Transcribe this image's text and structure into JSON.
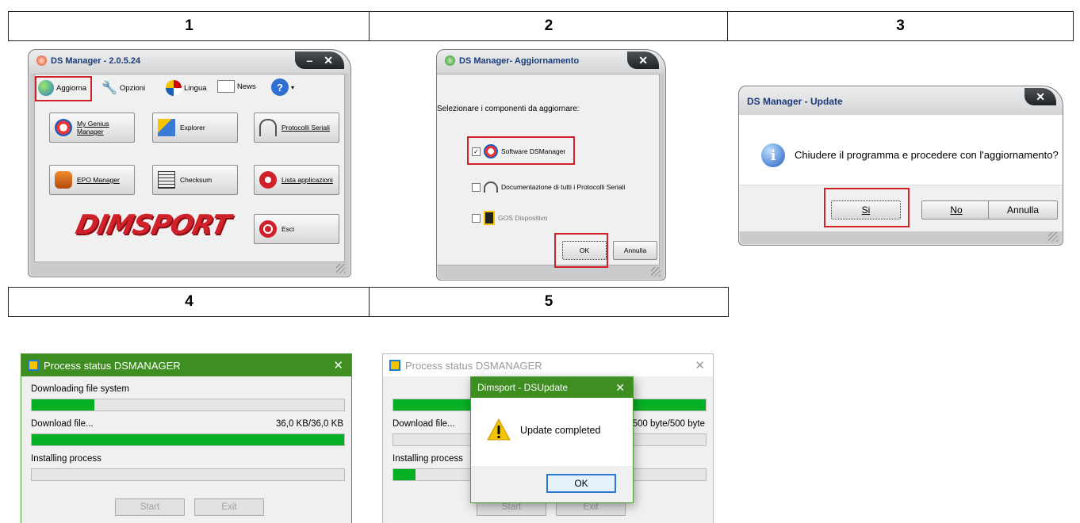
{
  "headers": [
    "1",
    "2",
    "3",
    "4",
    "5"
  ],
  "win1": {
    "title": "DS Manager - 2.0.5.24",
    "controls": [
      "–",
      "✕"
    ],
    "toolbar": [
      "Aggiorna",
      "Opzioni",
      "Lingua",
      "News",
      "?"
    ],
    "buttons": [
      "My Genius Manager",
      "Explorer",
      "Protocolli Seriali",
      "EPO Manager",
      "Checksum",
      "Lista applicazioni",
      "Esci"
    ],
    "logo": "DIMSPORT"
  },
  "win2": {
    "title": "DS Manager- Aggiornamento",
    "close": "✕",
    "prompt": "Selezionare i componenti da aggiornare:",
    "items": [
      {
        "label": "Software DSManager",
        "checked": true
      },
      {
        "label": "Documentazione di tutti i Protocolli Seriali",
        "checked": false
      },
      {
        "label": "GOS Dispositivo",
        "checked": false
      }
    ],
    "ok": "OK",
    "cancel": "Annulla"
  },
  "win3": {
    "title": "DS Manager - Update",
    "close": "✕",
    "icon": "info-icon",
    "message": "Chiudere il programma e procedere con l'aggiornamento?",
    "yes": "Si",
    "no": "No",
    "cancel": "Annulla"
  },
  "win4": {
    "title": "Process status DSMANAGER",
    "close": "✕",
    "labels": [
      "Downloading file system",
      "Download file...",
      "Installing process"
    ],
    "size": "36,0 KB/36,0 KB",
    "progress": [
      0.2,
      1.0,
      0.0
    ],
    "start": "Start",
    "exit": "Exit"
  },
  "win5": {
    "title": "Process status DSMANAGER",
    "close": "✕",
    "labels": [
      "Download file...",
      "Installing process"
    ],
    "size": "500 byte/500 byte",
    "progress": [
      1.0,
      0.0,
      0.07
    ],
    "start": "Start",
    "exit": "Exit",
    "dialog": {
      "title": "Dimsport - DSUpdate",
      "close": "✕",
      "icon": "warning-icon",
      "message": "Update completed",
      "ok": "OK"
    }
  },
  "colors": {
    "accent_red": "#d0202a",
    "progress_green": "#06b025",
    "title_green": "#3e8e22"
  }
}
